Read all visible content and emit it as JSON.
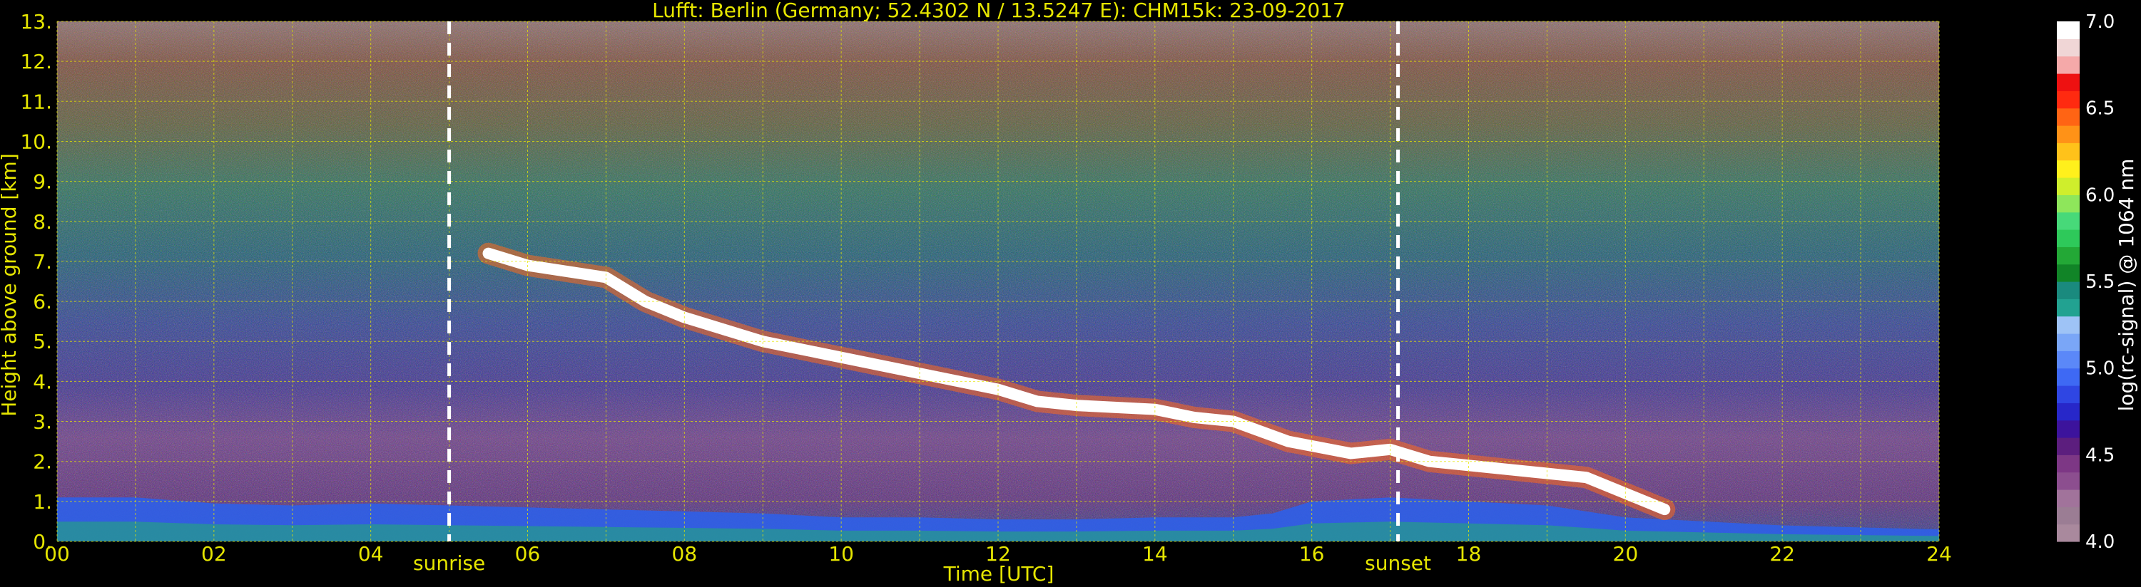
{
  "chart_data": {
    "type": "heatmap",
    "title": "Lufft: Berlin (Germany; 52.4302 N / 13.5247 E):    CHM15k: 23-09-2017",
    "xlabel": "Time [UTC]",
    "ylabel": "Height above ground [km]",
    "xlim": [
      0,
      24
    ],
    "ylim": [
      0,
      13
    ],
    "x_ticks": [
      "00",
      "02",
      "04",
      "06",
      "08",
      "10",
      "12",
      "14",
      "16",
      "18",
      "20",
      "22",
      "24"
    ],
    "y_ticks": [
      "0.",
      "1.",
      "2.",
      "3.",
      "4.",
      "5.",
      "6.",
      "7.",
      "8.",
      "9.",
      "10.",
      "11.",
      "12.",
      "13."
    ],
    "grid": true,
    "annotations": [
      {
        "text": "sunrise",
        "x": 5.0
      },
      {
        "text": "sunset",
        "x": 17.1
      }
    ],
    "colorbar": {
      "label": "log(rc-signal) @ 1064 nm",
      "range": [
        4.0,
        7.0
      ],
      "ticks": [
        "4.0",
        "4.5",
        "5.0",
        "5.5",
        "6.0",
        "6.5",
        "7.0"
      ],
      "colors": [
        "#a9899d",
        "#9b7d94",
        "#a1739b",
        "#8c4e8f",
        "#7d3785",
        "#5c1e7e",
        "#3c139c",
        "#2727c9",
        "#2f46e3",
        "#3e69f4",
        "#5b88f8",
        "#7aa6f7",
        "#9ec3f6",
        "#22a291",
        "#1a8a7e",
        "#118427",
        "#23a836",
        "#2ec95a",
        "#47d979",
        "#8ee65b",
        "#cfee2c",
        "#fff01c",
        "#ffc21a",
        "#ff9217",
        "#ff6414",
        "#ff2a10",
        "#ee1111",
        "#f5a9a9",
        "#f0d6d6",
        "#ffffff"
      ]
    },
    "series": [
      {
        "name": "",
        "layer": "boundary layer aerosol",
        "x": [
          0,
          1,
          2,
          3,
          4,
          5,
          6,
          7,
          8,
          9,
          10,
          11,
          12,
          13,
          14,
          15,
          15.5,
          16,
          17,
          18,
          19,
          20,
          21,
          22,
          23,
          24
        ],
        "y": [
          1.1,
          1.1,
          0.95,
          0.9,
          0.95,
          0.9,
          0.85,
          0.8,
          0.75,
          0.7,
          0.6,
          0.6,
          0.55,
          0.55,
          0.6,
          0.6,
          0.7,
          1.0,
          1.1,
          1.0,
          0.9,
          0.6,
          0.5,
          0.4,
          0.35,
          0.3
        ]
      },
      {
        "name": "",
        "layer": "cloud base",
        "x": [
          5.5,
          6.0,
          7.0,
          7.5,
          8.0,
          8.5,
          9.0,
          10.0,
          11.0,
          12.0,
          12.5,
          13.0,
          14.0,
          14.5,
          15.0,
          15.7,
          16.5,
          17.0,
          17.5,
          18.5,
          19.5,
          20.5
        ],
        "y": [
          7.2,
          6.9,
          6.6,
          6.0,
          5.6,
          5.3,
          5.0,
          4.6,
          4.2,
          3.8,
          3.5,
          3.4,
          3.3,
          3.1,
          3.0,
          2.5,
          2.2,
          2.3,
          2.0,
          1.8,
          1.6,
          0.8
        ]
      }
    ]
  }
}
